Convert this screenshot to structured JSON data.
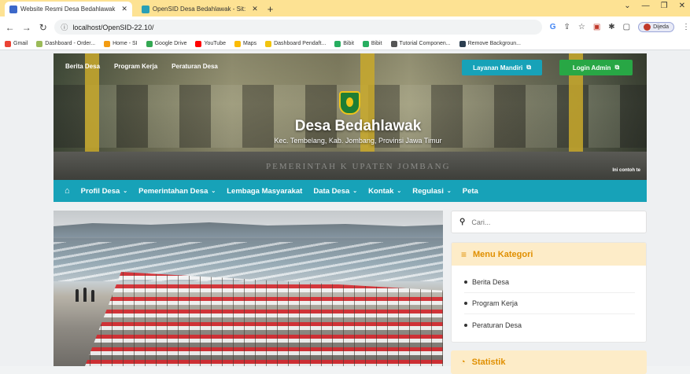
{
  "browser": {
    "tabs": [
      {
        "title": "Website Resmi Desa Bedahlawak",
        "close": "✕"
      },
      {
        "title": "OpenSID Desa Bedahlawak - Sit:",
        "close": "✕"
      }
    ],
    "new_tab": "+",
    "url": "localhost/OpenSID-22.10/",
    "profile_name": "Dijeda",
    "window_controls": {
      "min": "—",
      "max": "❐",
      "close": "✕"
    }
  },
  "bookmarks": [
    {
      "label": "Gmail",
      "color": "#ea4335"
    },
    {
      "label": "Dashboard - Order...",
      "color": "#9bbb59"
    },
    {
      "label": "Home - SI",
      "color": "#f39c12"
    },
    {
      "label": "Google Drive",
      "color": "#34a853"
    },
    {
      "label": "YouTube",
      "color": "#ff0000"
    },
    {
      "label": "Maps",
      "color": "#fbbc05"
    },
    {
      "label": "Dashboard Pendaft...",
      "color": "#f1c40f"
    },
    {
      "label": "Bibit",
      "color": "#27ae60"
    },
    {
      "label": "Bibit",
      "color": "#27ae60"
    },
    {
      "label": "Tutorial Componen...",
      "color": "#555555"
    },
    {
      "label": "Remove Backgroun...",
      "color": "#2c3e50"
    }
  ],
  "header": {
    "top_links": [
      "Berita Desa",
      "Program Kerja",
      "Peraturan Desa"
    ],
    "layanan_button": "Layanan Mandiri",
    "login_button": "Login Admin",
    "title": "Desa Bedahlawak",
    "subtitle": "Kec. Tembelang, Kab. Jombang, Provinsi Jawa Timur",
    "ticker": "Ini contoh te",
    "sign_text": "PEMERINTAH K   UPATEN JOMBANG"
  },
  "main_nav": [
    {
      "label": "Profil Desa",
      "dropdown": true
    },
    {
      "label": "Pemerintahan Desa",
      "dropdown": true
    },
    {
      "label": "Lembaga Masyarakat",
      "dropdown": false
    },
    {
      "label": "Data Desa",
      "dropdown": true
    },
    {
      "label": "Kontak",
      "dropdown": true
    },
    {
      "label": "Regulasi",
      "dropdown": true
    },
    {
      "label": "Peta",
      "dropdown": false
    }
  ],
  "sidebar": {
    "search_placeholder": "Cari...",
    "menu_title": "Menu Kategori",
    "categories": [
      "Berita Desa",
      "Program Kerja",
      "Peraturan Desa"
    ],
    "stat_title": "Statistik"
  },
  "colors": {
    "teal": "#17a2b8",
    "accent_orange": "#e08f00",
    "card_header": "#fdecc8"
  }
}
